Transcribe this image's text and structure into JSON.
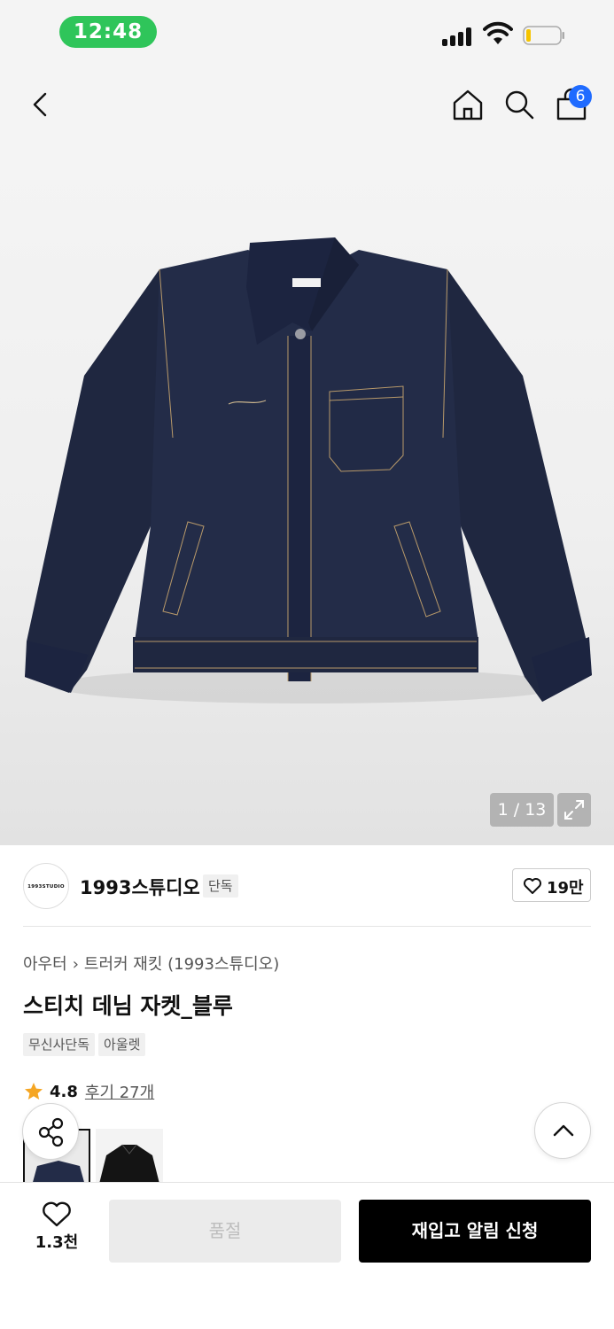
{
  "status_bar": {
    "time": "12:48"
  },
  "nav": {
    "back_icon": "chevron-left-icon",
    "home_icon": "home-icon",
    "search_icon": "search-icon",
    "cart_icon": "shopping-bag-icon",
    "cart_count": "6",
    "badge_color": "#1f6bff"
  },
  "gallery": {
    "counter": "1 / 13",
    "expand_icon": "expand-icon"
  },
  "brand": {
    "logo_text": "1993STUDIO",
    "name": "1993스튜디오",
    "tag": "단독",
    "like_count": "19만"
  },
  "product": {
    "breadcrumb": [
      "아우터",
      "트러커 재킷 (1993스튜디오)"
    ],
    "title": "스티치 데님 자켓_블루",
    "tags": [
      "무신사단독",
      "아울렛"
    ],
    "rating": "4.8",
    "review_label": "후기 27개",
    "rating_color": "#f5a623"
  },
  "floating": {
    "share_icon": "share-icon",
    "top_icon": "chevron-up-icon"
  },
  "bottom_bar": {
    "wish_count": "1.3천",
    "soldout_label": "품절",
    "restock_label": "재입고 알림 신청"
  }
}
